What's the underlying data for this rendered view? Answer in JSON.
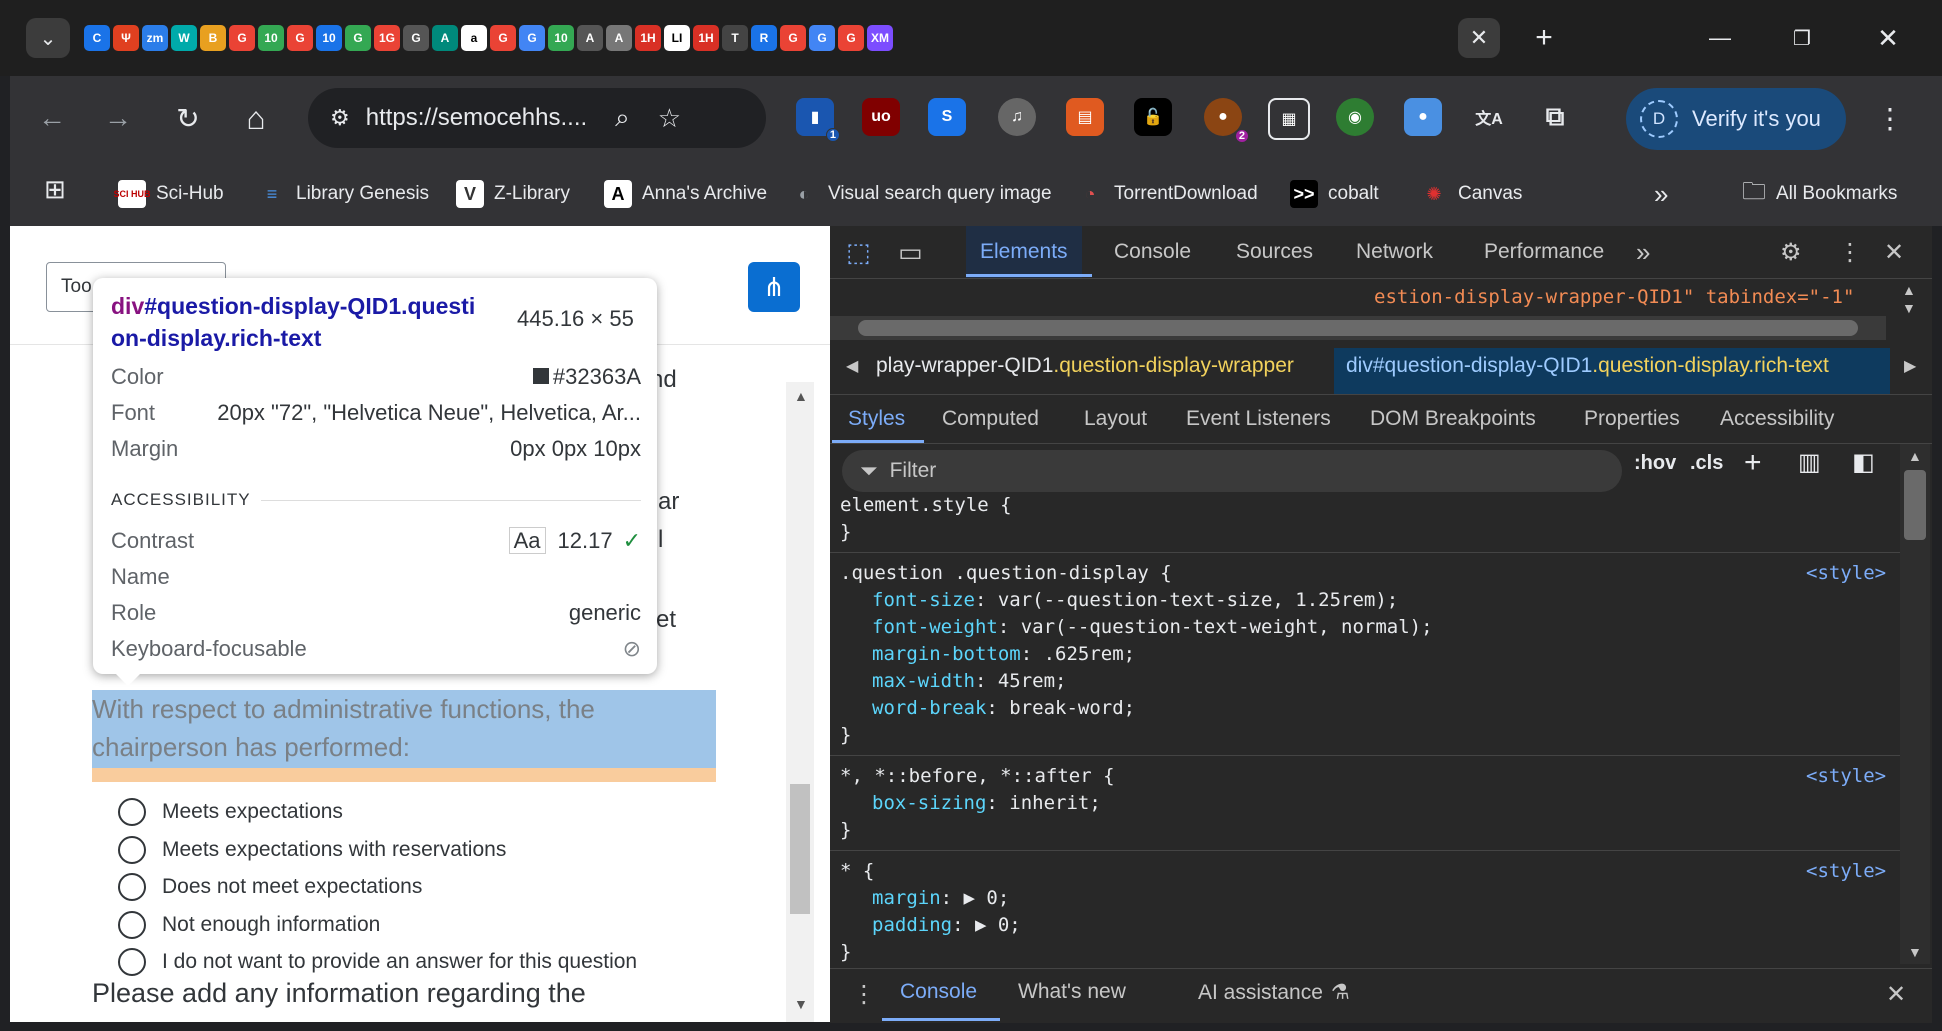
{
  "tabstrip": {
    "favicons": [
      "C",
      "Ψ",
      "zm",
      "W",
      "B",
      "G",
      "10",
      "G",
      "10",
      "G",
      "1G",
      "G",
      "A",
      "a",
      "G",
      "G",
      "10",
      "A",
      "A",
      "1H",
      "LI",
      "1H",
      "T",
      "R",
      "G",
      "G",
      "G",
      "XM"
    ],
    "close": "✕",
    "new_tab": "+"
  },
  "window": {
    "minimize": "—",
    "restore": "❐",
    "close": "✕"
  },
  "toolbar": {
    "back": "←",
    "forward": "→",
    "reload": "↻",
    "home": "⌂",
    "url": "https://semocehhs....",
    "verify_label": "Verify it's you",
    "verify_avatar": "D",
    "ext_badges": {
      "one": "1",
      "two": "2"
    },
    "menu": "⋮"
  },
  "bookmarks": {
    "items": [
      {
        "label": "Sci-Hub",
        "icon": "SCI HUB",
        "color": "#e8eaed"
      },
      {
        "label": "Library Genesis",
        "icon": "≡",
        "color": "#4a90e2"
      },
      {
        "label": "Z-Library",
        "icon": "V",
        "color": "#e8eaed"
      },
      {
        "label": "Anna's Archive",
        "icon": "A",
        "color": "#ffffff"
      },
      {
        "label": "Visual search query image",
        "icon": "◐",
        "color": "#9aa0a6"
      },
      {
        "label": "TorrentDownload",
        "icon": "◔",
        "color": "#e05050"
      },
      {
        "label": "cobalt",
        "icon": ">>",
        "color": "#ffffff"
      },
      {
        "label": "Canvas",
        "icon": "✺",
        "color": "#e03030"
      }
    ],
    "more": "»",
    "all_label": "All Bookmarks"
  },
  "page": {
    "tool_button": "Too",
    "partial_texts": [
      "nd",
      "ar",
      "l",
      "et"
    ],
    "question": "With respect to administrative functions, the chairperson has performed:",
    "options": [
      "Meets expectations",
      "Meets expectations with reservations",
      "Does not meet expectations",
      "Not enough information",
      "I do not want to provide an answer for this question"
    ],
    "next_question": "Please add any information regarding the"
  },
  "tooltip": {
    "selector_tag": "div",
    "selector_rest": "#question-display-QID1.questi",
    "selector_line2": "on-display.rich-text",
    "size": "445.16 × 55",
    "color_label": "Color",
    "color_value": "#32363A",
    "font_label": "Font",
    "font_value": "20px \"72\", \"Helvetica Neue\", Helvetica, Ar...",
    "margin_label": "Margin",
    "margin_value": "0px 0px 10px",
    "accessibility_header": "ACCESSIBILITY",
    "contrast_label": "Contrast",
    "contrast_aa": "Aa",
    "contrast_value": "12.17",
    "name_label": "Name",
    "role_label": "Role",
    "role_value": "generic",
    "keyboard_label": "Keyboard-focusable"
  },
  "devtools": {
    "tabs": [
      "Elements",
      "Console",
      "Sources",
      "Network",
      "Performance"
    ],
    "more": "»",
    "top_code": "estion-display-wrapper-QID1\" tabindex=\"-1\"",
    "breadcrumb1_pre": "play-wrapper-QID1",
    "breadcrumb1_cls": ".question-display-wrapper",
    "breadcrumb2_pre": "div#question-display-QID1",
    "breadcrumb2_cls": ".question-display.rich-text",
    "subtabs": [
      "Styles",
      "Computed",
      "Layout",
      "Event Listeners",
      "DOM Breakpoints",
      "Properties",
      "Accessibility"
    ],
    "filter_placeholder": "Filter",
    "hov": ":hov",
    "cls": ".cls",
    "rules": [
      {
        "selector": "element.style {",
        "source": "",
        "props": []
      },
      {
        "selector": ".question .question-display {",
        "source": "<style>",
        "props": [
          {
            "name": "font-size",
            "value": "var(--question-text-size, 1.25rem);"
          },
          {
            "name": "font-weight",
            "value": "var(--question-text-weight, normal);"
          },
          {
            "name": "margin-bottom",
            "value": ".625rem;"
          },
          {
            "name": "max-width",
            "value": "45rem;"
          },
          {
            "name": "word-break",
            "value": "break-word;"
          }
        ]
      },
      {
        "selector": "*, *::before, *::after {",
        "source": "<style>",
        "props": [
          {
            "name": "box-sizing",
            "value": "inherit;"
          }
        ]
      },
      {
        "selector": "* {",
        "source": "<style>",
        "props": [
          {
            "name": "margin",
            "value": "▶ 0;"
          },
          {
            "name": "padding",
            "value": "▶ 0;"
          }
        ]
      }
    ],
    "drawer_tabs": [
      "Console",
      "What's new",
      "AI assistance"
    ]
  },
  "colors": {
    "accent": "#7cacf8",
    "highlight": "#9fc5e8",
    "margin_highlight": "#f9cc9d",
    "share": "#0a6ed1"
  }
}
